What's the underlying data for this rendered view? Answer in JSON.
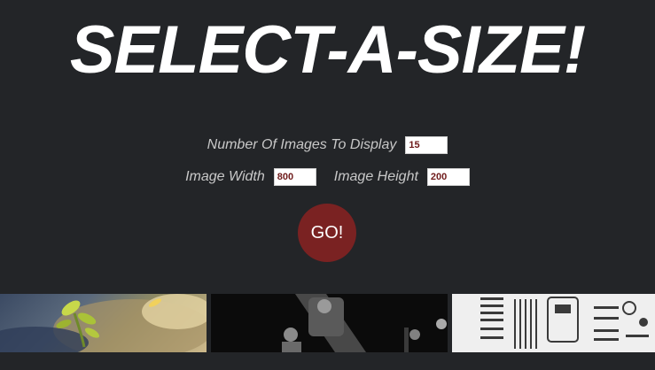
{
  "header": {
    "title": "SELECT-A-SIZE!"
  },
  "form": {
    "count_label": "Number Of Images To Display",
    "count_value": "15",
    "width_label": "Image Width",
    "width_value": "800",
    "height_label": "Image Height",
    "height_value": "200",
    "go_label": "GO!"
  },
  "colors": {
    "background": "#232528",
    "title": "#ffffff",
    "label": "#c8c8c8",
    "input_text": "#6e1a1a",
    "go_button": "#7a2222"
  },
  "gallery": {
    "images": [
      {
        "subject": "plant-sprout-on-rock-photo"
      },
      {
        "subject": "concert-musicians-bw-photo"
      },
      {
        "subject": "flatlay-hardware-parts-photo"
      }
    ]
  }
}
